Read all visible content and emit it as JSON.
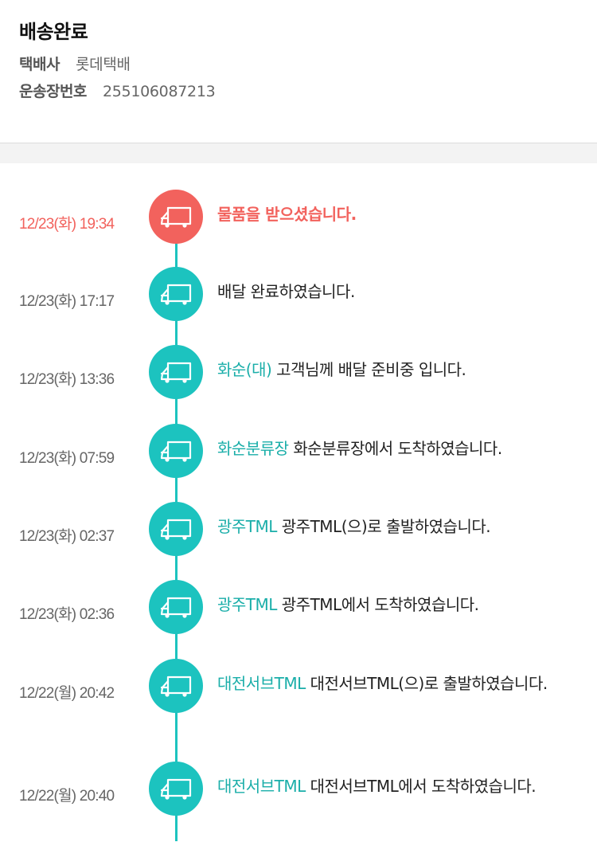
{
  "header": {
    "status_title": "배송완료",
    "carrier_label": "택배사",
    "carrier_value": "롯데택배",
    "tracking_label": "운송장번호",
    "tracking_value": "255106087213"
  },
  "colors": {
    "accent_teal": "#1cc3bf",
    "location_teal": "#1aaea9",
    "current_red": "#f2625d"
  },
  "timeline": {
    "icon": "truck-icon",
    "events": [
      {
        "time": "12/23(화) 19:34",
        "location": "",
        "message": "물품을 받으셨습니다.",
        "current": true
      },
      {
        "time": "12/23(화) 17:17",
        "location": "",
        "message": "배달 완료하였습니다.",
        "current": false
      },
      {
        "time": "12/23(화) 13:36",
        "location": "화순(대)",
        "message": "고객님께 배달 준비중 입니다.",
        "current": false
      },
      {
        "time": "12/23(화) 07:59",
        "location": "화순분류장",
        "message": "화순분류장에서 도착하였습니다.",
        "current": false
      },
      {
        "time": "12/23(화) 02:37",
        "location": "광주TML",
        "message": "광주TML(으)로 출발하였습니다.",
        "current": false
      },
      {
        "time": "12/23(화) 02:36",
        "location": "광주TML",
        "message": "광주TML에서 도착하였습니다.",
        "current": false
      },
      {
        "time": "12/22(월) 20:42",
        "location": "대전서브TML",
        "message": "대전서브TML(으)로 출발하였습니다.",
        "current": false
      },
      {
        "time": "12/22(월) 20:40",
        "location": "대전서브TML",
        "message": "대전서브TML에서 도착하였습니다.",
        "current": false
      }
    ]
  }
}
